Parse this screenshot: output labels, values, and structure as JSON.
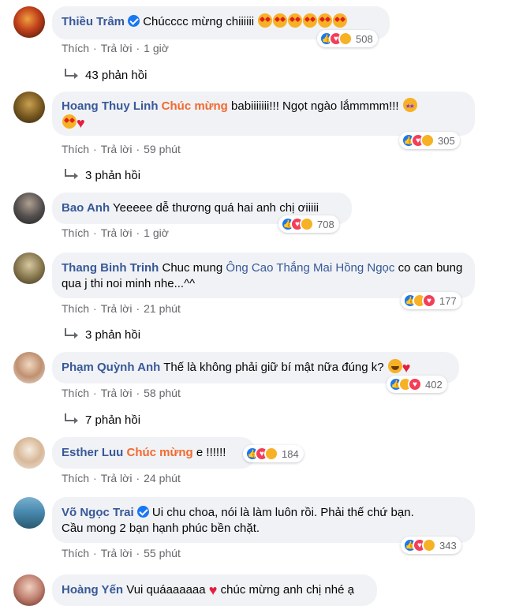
{
  "action_labels": {
    "like": "Thích",
    "reply": "Trả lời",
    "separator": "·"
  },
  "colors": {
    "author": "#385898",
    "mention_orange": "#f2692e",
    "bubble": "#f0f2f5",
    "meta": "#65676b"
  },
  "comments": [
    {
      "author": "Thiều Trâm",
      "verified": true,
      "text": "Chúcccc mừng chiiiiii",
      "emojis": [
        "smiling-hearts",
        "smiling-hearts",
        "heart-eyes",
        "heart-eyes",
        "heart-eyes",
        "heart-eyes"
      ],
      "time": "1 giờ",
      "reactions": [
        "like",
        "love",
        "haha"
      ],
      "reaction_count": "508",
      "replies": "43 phản hồi"
    },
    {
      "author": "Hoang Thuy Linh",
      "mention": "Chúc mừng",
      "text": "babiiiiiii!!! Ngọt ngào lắmmmm!!!",
      "emojis": [
        "star-struck",
        "heart-eyes",
        "red-heart"
      ],
      "time": "59 phút",
      "reactions": [
        "like",
        "love",
        "haha"
      ],
      "reaction_count": "305",
      "replies": "3 phản hồi"
    },
    {
      "author": "Bao Anh",
      "text": "Yeeeee dễ thương quá hai anh chị ơiiiii",
      "time": "1 giờ",
      "reactions": [
        "like",
        "love",
        "haha"
      ],
      "reaction_count": "708"
    },
    {
      "author": "Thang Binh Trinh",
      "text_before": "Chuc mung",
      "mention_link": "Ông Cao Thắng Mai Hồng Ngọc",
      "text": "co can bung qua j thi noi minh nhe...^^",
      "time": "21 phút",
      "reactions": [
        "like",
        "haha",
        "love"
      ],
      "reaction_count": "177",
      "replies": "3 phản hồi"
    },
    {
      "author": "Phạm Quỳnh Anh",
      "text": "Thế là không phải giữ bí mật nữa đúng k?",
      "emojis": [
        "rolling-laugh",
        "red-heart"
      ],
      "time": "58 phút",
      "reactions": [
        "like",
        "haha",
        "love"
      ],
      "reaction_count": "402",
      "replies": "7 phản hồi"
    },
    {
      "author": "Esther Luu",
      "mention": "Chúc mừng",
      "text": "e !!!!!!",
      "time": "24 phút",
      "reactions": [
        "like",
        "love",
        "haha"
      ],
      "reaction_count": "184"
    },
    {
      "author": "Võ Ngọc Trai",
      "verified": true,
      "text": "Ui chu choa, nói là làm luôn rồi. Phải thế chứ bạn.",
      "text2": "Cầu mong 2 bạn hạnh phúc bền chặt.",
      "time": "55 phút",
      "reactions": [
        "like",
        "love",
        "haha"
      ],
      "reaction_count": "343"
    },
    {
      "author": "Hoàng Yến",
      "text": "Vui quáaaaaaa",
      "text_after": "chúc mừng anh chị nhé ạ",
      "emojis": [
        "red-heart"
      ]
    }
  ]
}
